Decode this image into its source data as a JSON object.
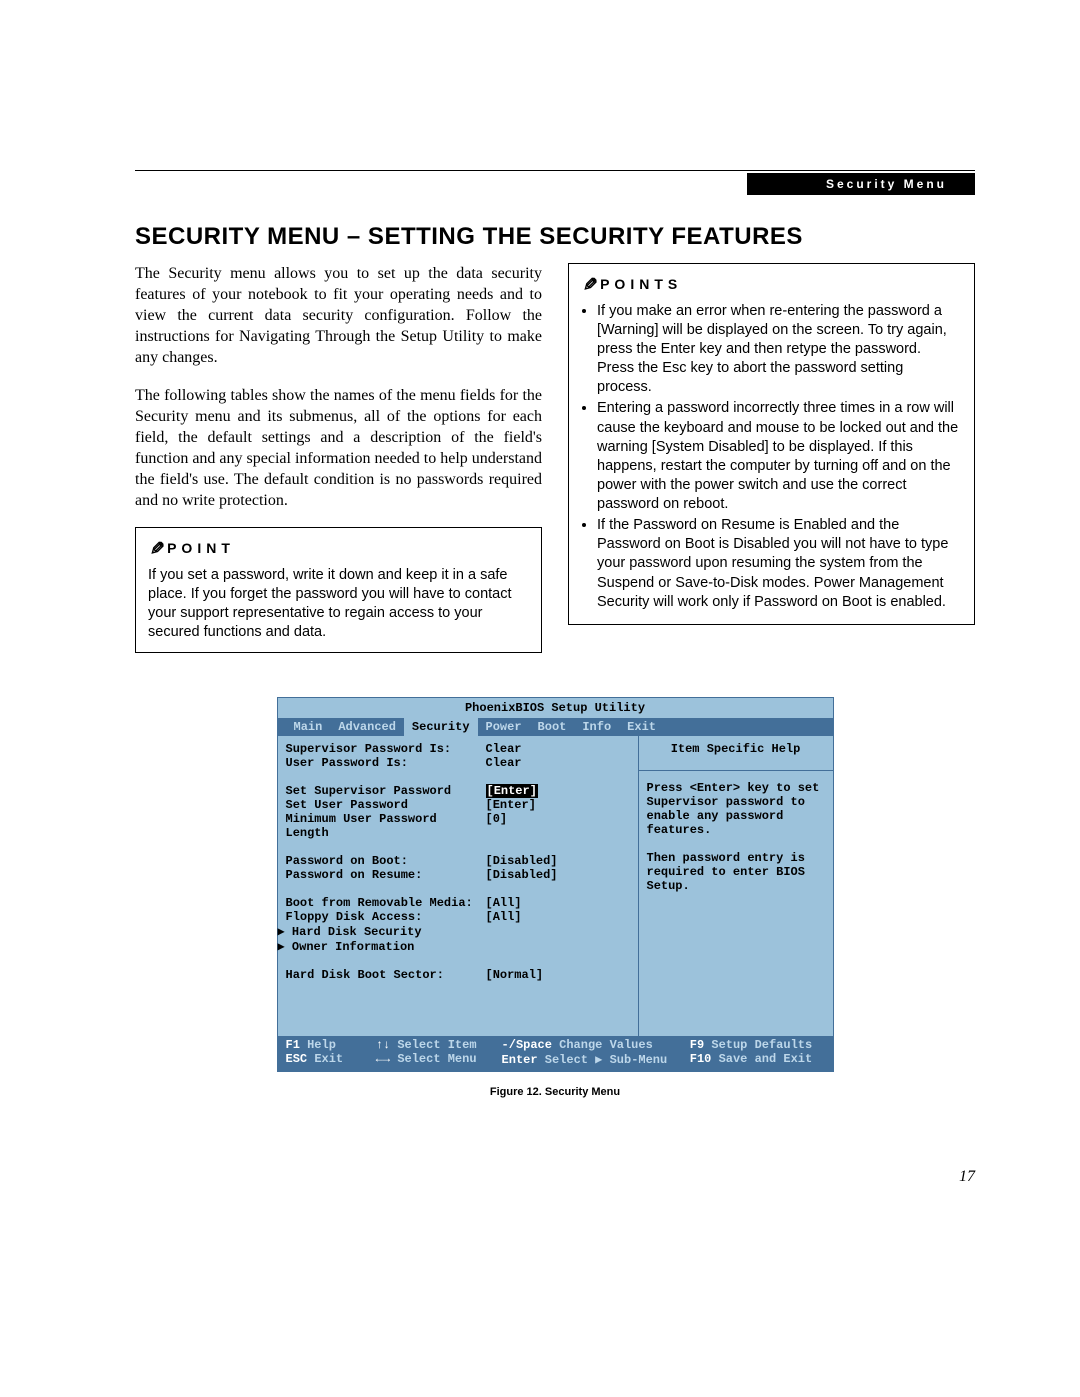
{
  "header": {
    "chip": "Security Menu"
  },
  "title": "SECURITY MENU – SETTING THE SECURITY FEATURES",
  "intro1": "The Security menu allows you to set up the data security features of your notebook to fit your operating needs and to view the current data security configuration. Follow the instructions for Navigating Through the Setup Utility to make any changes.",
  "intro2": "The following tables show the names of the menu fields for the Security menu and its submenus, all of the options for each field, the default settings and a description of the field's function and any special information needed to help understand the field's use. The default condition is no passwords required and no write protection.",
  "point1": {
    "label": "POINT",
    "text": "If you set a password, write it down and keep it in a safe place. If you forget the password you will have to contact your support representative to regain access to your secured functions and data."
  },
  "points": {
    "label": "POINTS",
    "items": [
      "If you make an error when re-entering the password a [Warning] will be displayed on the screen. To try again, press the Enter key and then retype the password. Press the Esc key to abort the password setting process.",
      "Entering a password incorrectly three times in a row will cause the keyboard and mouse to be locked out and the warning [System Disabled] to be displayed. If this happens, restart the computer by turning off and on the power with the power switch and use the correct password on reboot.",
      "If the Password on Resume is Enabled and the Password on Boot is Disabled you will not have to type your password upon resuming the system from the Suspend or Save-to-Disk modes. Power Management Security will work only if Password on Boot is enabled."
    ]
  },
  "bios": {
    "title": "PhoenixBIOS Setup Utility",
    "tabs": [
      "Main",
      "Advanced",
      "Security",
      "Power",
      "Boot",
      "Info",
      "Exit"
    ],
    "active_tab": "Security",
    "rows": [
      {
        "label": "Supervisor Password Is:",
        "value": "Clear"
      },
      {
        "label": "User Password Is:",
        "value": "Clear"
      },
      {
        "blank": true
      },
      {
        "label": "Set Supervisor Password",
        "value": "[Enter]",
        "selected": true
      },
      {
        "label": "Set User Password",
        "value": "[Enter]"
      },
      {
        "label": "Minimum User Password Length",
        "value": "[0]"
      },
      {
        "blank": true
      },
      {
        "label": "Password on Boot:",
        "value": "[Disabled]"
      },
      {
        "label": "Password on Resume:",
        "value": "[Disabled]"
      },
      {
        "blank": true
      },
      {
        "label": "Boot from Removable Media:",
        "value": "[All]"
      },
      {
        "label": "Floppy Disk Access:",
        "value": "[All]"
      },
      {
        "label": "▶ Hard Disk Security",
        "value": "",
        "indent": true
      },
      {
        "label": "▶ Owner Information",
        "value": "",
        "indent": true
      },
      {
        "blank": true
      },
      {
        "label": "Hard Disk Boot Sector:",
        "value": "[Normal]"
      }
    ],
    "help": {
      "title": "Item Specific Help",
      "text1": "Press <Enter> key to set Supervisor password to enable any password features.",
      "text2": "Then password entry is required to enter BIOS Setup."
    },
    "footer": {
      "r1": [
        {
          "k": "F1",
          "v": "Help"
        },
        {
          "k": "↑↓",
          "v": "Select Item"
        },
        {
          "k": "-/Space",
          "v": "Change Values"
        },
        {
          "k": "F9",
          "v": "Setup Defaults"
        }
      ],
      "r2": [
        {
          "k": "ESC",
          "v": "Exit"
        },
        {
          "k": "←→",
          "v": "Select Menu"
        },
        {
          "k": "Enter",
          "v": "Select ▶ Sub-Menu"
        },
        {
          "k": "F10",
          "v": "Save and Exit"
        }
      ]
    }
  },
  "figure_caption": "Figure 12.  Security Menu",
  "page_number": "17"
}
